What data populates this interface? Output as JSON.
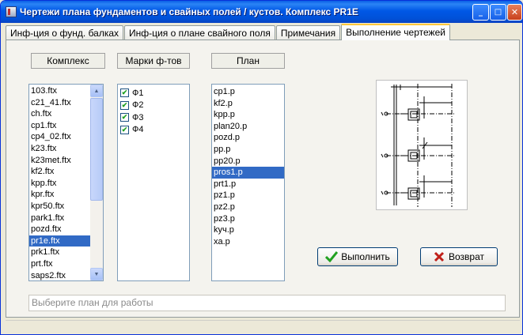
{
  "window": {
    "title": "Чертежи плана фундаментов и свайных полей / кустов. Комплекс PR1E",
    "minimize_glyph": "_",
    "maximize_glyph": "□",
    "close_glyph": "✕"
  },
  "tabs": [
    {
      "label": "Инф-ция о фунд. балках"
    },
    {
      "label": "Инф-ция о плане свайного поля"
    },
    {
      "label": "Примечания"
    },
    {
      "label": "Выполнение чертежей"
    }
  ],
  "active_tab_index": 3,
  "headers": {
    "complex": "Комплекс",
    "marks": "Марки ф-тов",
    "plan": "План"
  },
  "complex_list": {
    "items": [
      "103.ftx",
      "c21_41.ftx",
      "ch.ftx",
      "cp1.ftx",
      "cp4_02.ftx",
      "k23.ftx",
      "k23met.ftx",
      "kf2.ftx",
      "kpp.ftx",
      "kpr.ftx",
      "kpr50.ftx",
      "park1.ftx",
      "pozd.ftx",
      "pr1e.ftx",
      "prk1.ftx",
      "prt.ftx",
      "saps2.ftx"
    ],
    "selected": "pr1e.ftx"
  },
  "marks_list": {
    "items": [
      {
        "label": "Ф1",
        "checked": true
      },
      {
        "label": "Ф2",
        "checked": true
      },
      {
        "label": "Ф3",
        "checked": true
      },
      {
        "label": "Ф4",
        "checked": true
      }
    ]
  },
  "plan_list": {
    "items": [
      "cp1.p",
      "kf2.p",
      "kpp.p",
      "plan20.p",
      "pozd.p",
      "pp.p",
      "pp20.p",
      "pros1.p",
      "prt1.p",
      "pz1.p",
      "pz2.p",
      "pz3.p",
      "kyч.p",
      "xa.p"
    ],
    "selected": "pros1.p"
  },
  "buttons": {
    "execute": "Выполнить",
    "back": "Возврат"
  },
  "hint": {
    "text": "Выберите план для работы"
  },
  "colors": {
    "titlebar": "#0058e6",
    "selection": "#316ac5",
    "check_green": "#21a121",
    "cancel_red": "#c0201a"
  }
}
